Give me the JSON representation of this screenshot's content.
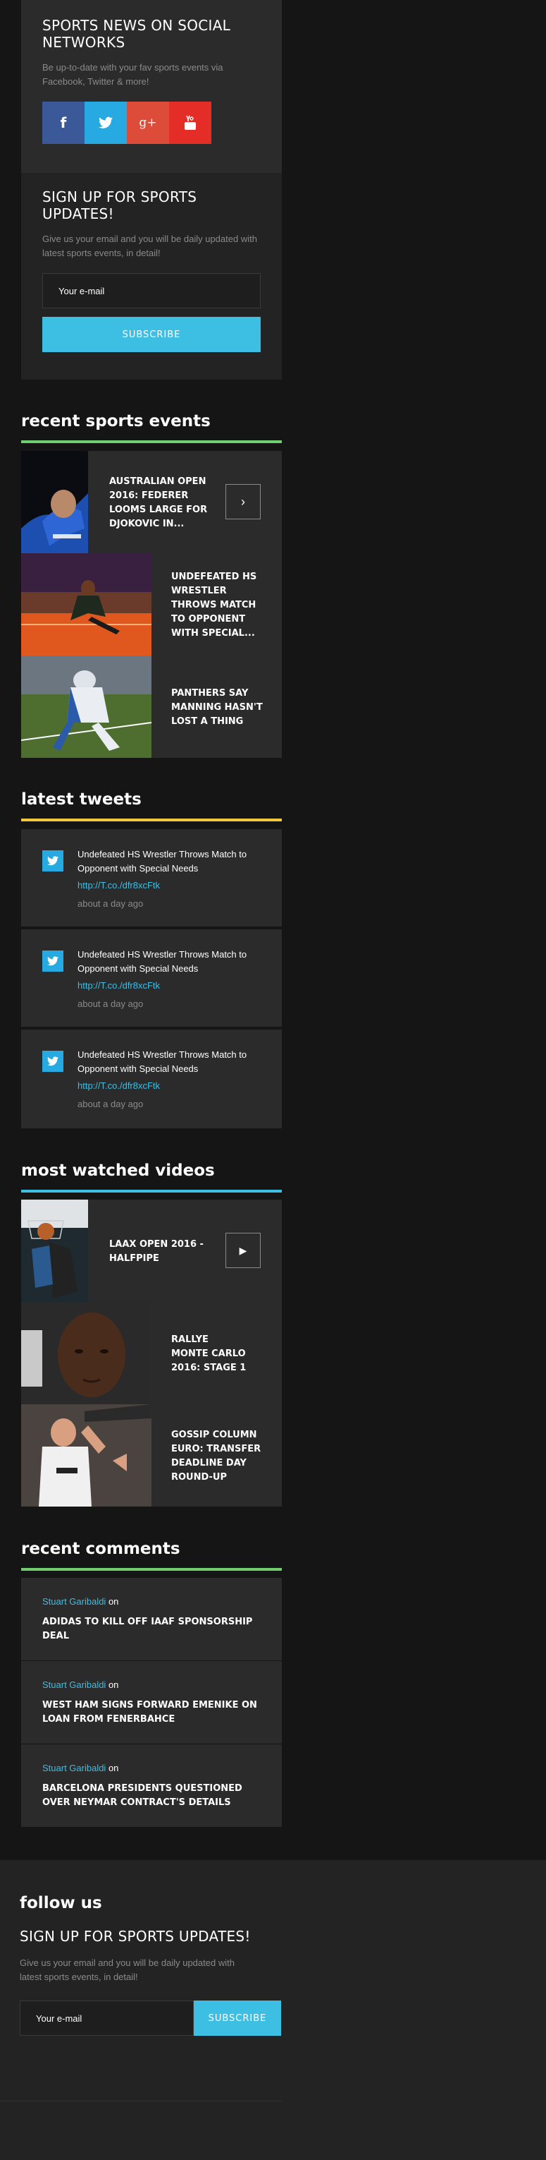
{
  "social": {
    "title": "SPORTS NEWS ON SOCIAL NETWORKS",
    "text": "Be up-to-date with your fav sports events via Facebook, Twitter & more!",
    "buttons": [
      {
        "name": "facebook",
        "glyph": "f",
        "color": "#3b5998"
      },
      {
        "name": "twitter",
        "glyph": "t",
        "color": "#27aae1"
      },
      {
        "name": "google-plus",
        "glyph": "g+",
        "color": "#dd4b39"
      },
      {
        "name": "youtube",
        "glyph": "▶",
        "color": "#e52d27"
      }
    ]
  },
  "signup": {
    "title": "SIGN UP FOR SPORTS UPDATES!",
    "text": "Give us your email and you will be daily updated with latest sports events, in detail!",
    "email_placeholder": "Your e-mail",
    "button": "SUBSCRIBE"
  },
  "recent_events": {
    "title": "recent sports events",
    "accent": "#6fce70",
    "items": [
      {
        "title": "AUSTRALIAN OPEN 2016: FEDERER LOOMS LARGE FOR DJOKOVIC IN...",
        "arrow": "›"
      },
      {
        "title": "UNDEFEATED HS WRESTLER THROWS MATCH TO OPPONENT WITH SPECIAL..."
      },
      {
        "title": "PANTHERS SAY MANNING HASN'T LOST A THING"
      }
    ]
  },
  "tweets": {
    "title": "latest tweets",
    "accent": "#f0c93e",
    "items": [
      {
        "text": "Undefeated HS Wrestler Throws Match to Opponent with Special Needs",
        "link": "http://T.co./dfr8xcFtk",
        "time": "about a day ago"
      },
      {
        "text": "Undefeated HS Wrestler Throws Match to Opponent with Special Needs",
        "link": "http://T.co./dfr8xcFtk",
        "time": "about a day ago"
      },
      {
        "text": "Undefeated HS Wrestler Throws Match to Opponent with Special Needs",
        "link": "http://T.co./dfr8xcFtk",
        "time": "about a day ago"
      }
    ]
  },
  "videos": {
    "title": "most watched videos",
    "accent": "#3dbfe4",
    "items": [
      {
        "title": "LAAX OPEN 2016 - HALFPIPE",
        "play": "▶"
      },
      {
        "title": "RALLYE MONTE CARLO 2016: STAGE 1"
      },
      {
        "title": "GOSSIP COLUMN EURO: TRANSFER DEADLINE DAY ROUND-UP"
      }
    ]
  },
  "comments": {
    "title": "recent comments",
    "accent": "#6fce70",
    "items": [
      {
        "author": "Stuart Garibaldi",
        "on": "on",
        "title": "ADIDAS TO KILL OFF IAAF SPONSORSHIP DEAL"
      },
      {
        "author": "Stuart Garibaldi",
        "on": "on",
        "title": "WEST HAM SIGNS FORWARD EMENIKE ON LOAN FROM FENERBAHCE"
      },
      {
        "author": "Stuart Garibaldi",
        "on": "on",
        "title": "BARCELONA PRESIDENTS QUESTIONED OVER NEYMAR CONTRACT'S DETAILS"
      }
    ]
  },
  "footer": {
    "follow": "follow us",
    "title": "SIGN UP FOR SPORTS UPDATES!",
    "text": "Give us your email and you will be daily updated with latest sports events, in detail!",
    "email_placeholder": "Your e-mail",
    "button": "SUBSCRIBE"
  }
}
